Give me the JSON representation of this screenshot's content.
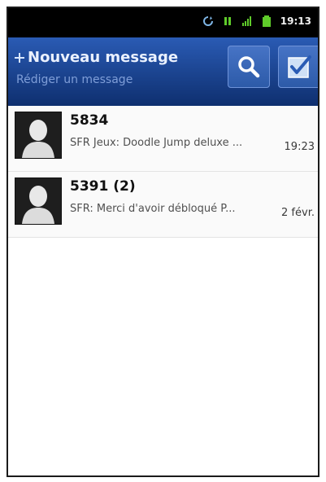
{
  "status_bar": {
    "time": "19:13",
    "icons": [
      "sync-icon",
      "data-icon",
      "signal-icon",
      "battery-icon"
    ]
  },
  "action_bar": {
    "title": "Nouveau message",
    "subtitle": "Rédiger un message",
    "title_icon": "plus-icon",
    "search_icon": "search-icon",
    "select_icon": "select-checkbox-icon"
  },
  "conversations": [
    {
      "sender": "5834",
      "snippet": "SFR Jeux: Doodle Jump deluxe ...",
      "time": "19:23"
    },
    {
      "sender": "5391 (2)",
      "snippet": "SFR: Merci d'avoir débloqué P...",
      "time": "2 févr."
    }
  ],
  "colors": {
    "action_bar_top": "#2a5bb4",
    "action_bar_bottom": "#0e2f6f",
    "status_bar": "#000000",
    "signal_green": "#5fcb2a"
  }
}
